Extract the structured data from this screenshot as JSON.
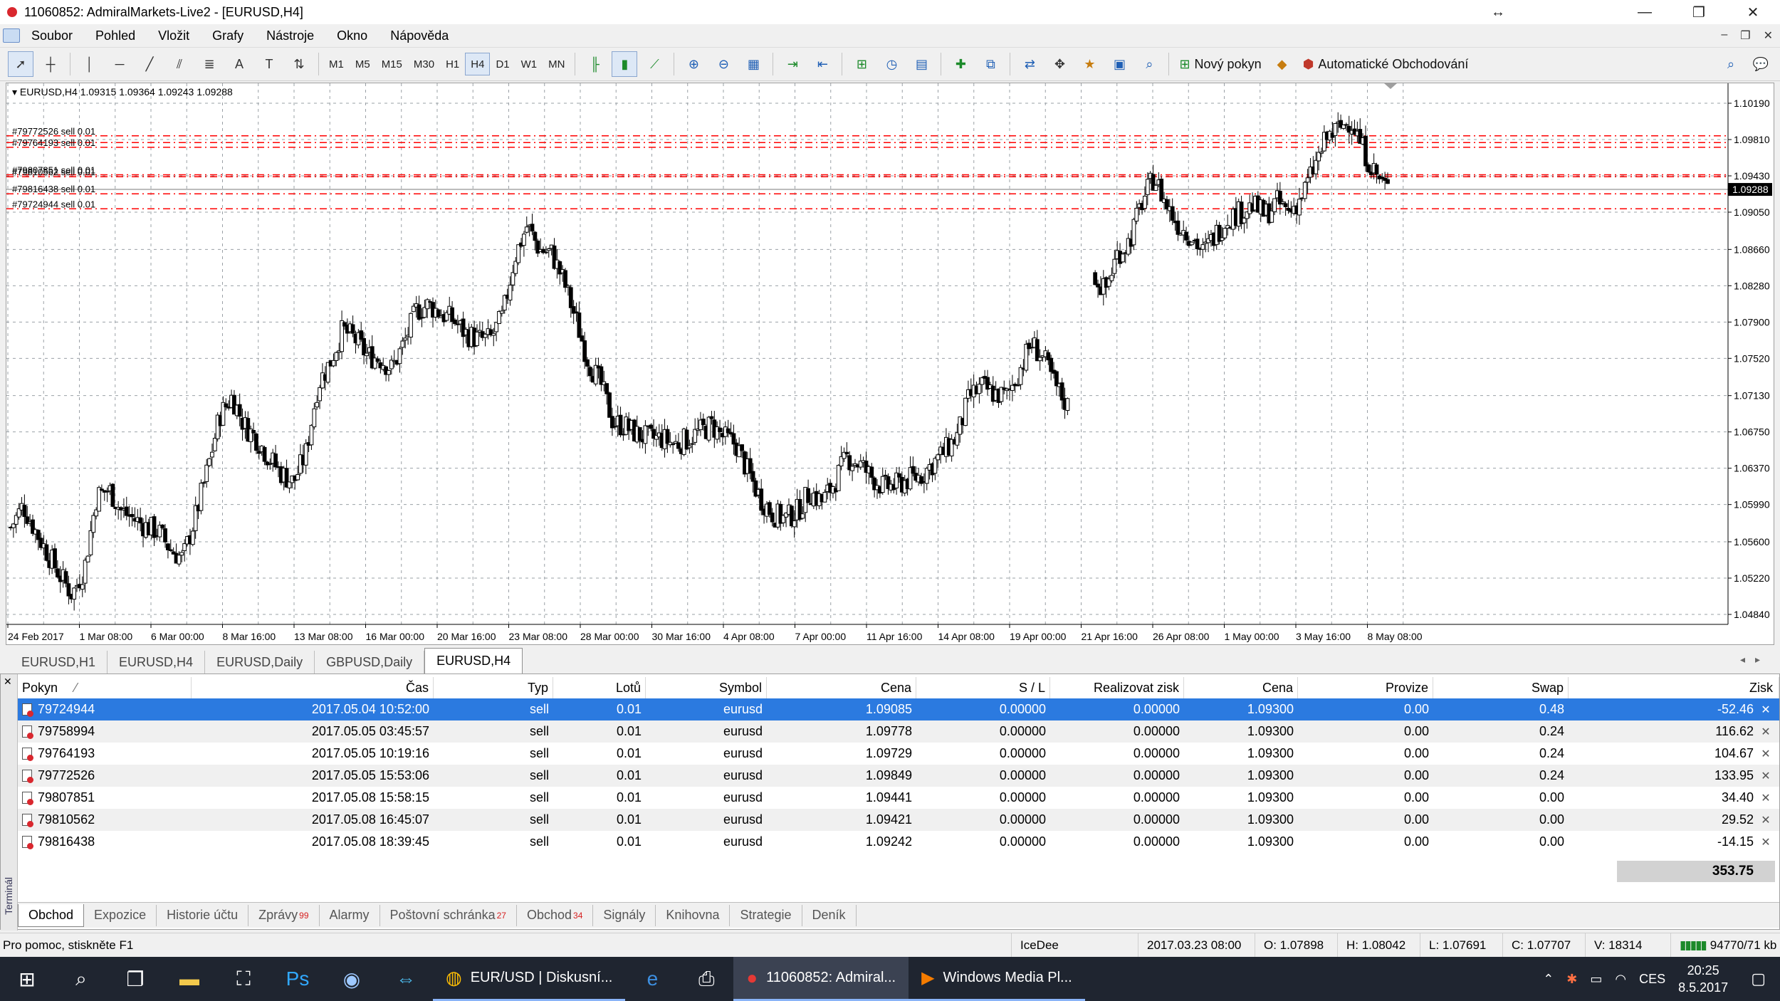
{
  "window": {
    "title": "11060852: AdmiralMarkets-Live2 - [EURUSD,H4]",
    "controls": {
      "minimize": "—",
      "restore": "❐",
      "close": "✕",
      "resize": "↔"
    }
  },
  "menu": {
    "items": [
      "Soubor",
      "Pohled",
      "Vložit",
      "Grafy",
      "Nástroje",
      "Okno",
      "Nápověda"
    ]
  },
  "toolbar": {
    "timeframes": [
      "M1",
      "M5",
      "M15",
      "M30",
      "H1",
      "H4",
      "D1",
      "W1",
      "MN"
    ],
    "active_timeframe": "H4",
    "new_order_label": "Nový pokyn",
    "auto_trading_label": "Automatické Obchodování"
  },
  "chart": {
    "info_line": "EURUSD,H4  1.09315 1.09364 1.09243 1.09288",
    "current_price": "1.09288",
    "order_labels": [
      {
        "text": "#79772526 sell 0.01",
        "price": 1.09849
      },
      {
        "text": "#79764193 sell 0.01",
        "price": 1.09729
      },
      {
        "text": "#79807851 sell 0.01",
        "price": 1.09441
      },
      {
        "text": "#79810562 sell 0.01",
        "price": 1.09421
      },
      {
        "text": "#79816438 sell 0.01",
        "price": 1.09242
      },
      {
        "text": "#79724944 sell 0.01",
        "price": 1.09085
      }
    ],
    "extra_line_price": 1.09778
  },
  "chart_data": {
    "type": "candlestick",
    "title": "EURUSD,H4",
    "ylim": [
      1.0484,
      1.1019
    ],
    "y_ticks": [
      "1.10190",
      "1.09810",
      "1.09430",
      "1.09050",
      "1.08660",
      "1.08280",
      "1.07900",
      "1.07520",
      "1.07130",
      "1.06750",
      "1.06370",
      "1.05990",
      "1.05600",
      "1.05220",
      "1.04840"
    ],
    "x_ticks": [
      "24 Feb 2017",
      "1 Mar 08:00",
      "6 Mar 00:00",
      "8 Mar 16:00",
      "13 Mar 08:00",
      "16 Mar 00:00",
      "20 Mar 16:00",
      "23 Mar 08:00",
      "28 Mar 00:00",
      "30 Mar 16:00",
      "4 Apr 08:00",
      "7 Apr 00:00",
      "11 Apr 16:00",
      "14 Apr 08:00",
      "19 Apr 00:00",
      "21 Apr 16:00",
      "26 Apr 08:00",
      "1 May 00:00",
      "3 May 16:00",
      "8 May 08:00"
    ],
    "close_path": [
      1.0575,
      1.0598,
      1.0572,
      1.0548,
      1.0525,
      1.0505,
      1.0532,
      1.0608,
      1.0615,
      1.0592,
      1.0584,
      1.0576,
      1.0571,
      1.0552,
      1.0542,
      1.0585,
      1.0635,
      1.0692,
      1.0712,
      1.0682,
      1.0668,
      1.0648,
      1.0632,
      1.0622,
      1.0652,
      1.0725,
      1.0748,
      1.0782,
      1.0772,
      1.0755,
      1.0752,
      1.0741,
      1.0768,
      1.0802,
      1.0808,
      1.0799,
      1.0792,
      1.0778,
      1.0772,
      1.0772,
      1.0795,
      1.0858,
      1.0891,
      1.0866,
      1.0862,
      1.0832,
      1.0791,
      1.0748,
      1.0725,
      1.0685,
      1.0681,
      1.0672,
      1.0668,
      1.0668,
      1.0662,
      1.0667,
      1.0675,
      1.0682,
      1.0669,
      1.0662,
      1.0632,
      1.0605,
      1.0589,
      1.0584,
      1.0592,
      1.0612,
      1.0602,
      1.0622,
      1.0648,
      1.0642,
      1.0628,
      1.0617,
      1.0619,
      1.0625,
      1.0629,
      1.0642,
      1.0655,
      1.0671,
      1.0712,
      1.0722,
      1.0715,
      1.0712,
      1.0738,
      1.0768,
      1.0752,
      1.0722,
      1.0702,
      null,
      1.0842,
      1.0822,
      1.0861,
      1.0875,
      1.0915,
      1.0942,
      1.0912,
      1.0891,
      1.0881,
      1.0862,
      1.0882,
      1.0899,
      1.0905,
      1.0912,
      1.0902,
      1.0915,
      1.0905,
      1.0921,
      1.0951,
      1.0982,
      1.0992,
      1.1002,
      1.0971,
      1.0945,
      1.0929
    ],
    "series_color": "#000000",
    "up_candle_fill": "#ffffff",
    "down_candle_fill": "#000000",
    "order_line_color": "#ff0000"
  },
  "chart_tabs": [
    "EURUSD,H1",
    "EURUSD,H4",
    "EURUSD,Daily",
    "GBPUSD,Daily",
    "EURUSD,H4"
  ],
  "active_chart_tab": 4,
  "terminal": {
    "side_label": "Terminál",
    "columns": [
      "Pokyn",
      "Čas",
      "Typ",
      "Lotů",
      "Symbol",
      "Cena",
      "S / L",
      "Realizovat zisk",
      "Cena",
      "Provize",
      "Swap",
      "Zisk"
    ],
    "sort_indicator": "⁄",
    "rows": [
      [
        "79724944",
        "2017.05.04 10:52:00",
        "sell",
        "0.01",
        "eurusd",
        "1.09085",
        "0.00000",
        "0.00000",
        "1.09300",
        "0.00",
        "0.48",
        "-52.46"
      ],
      [
        "79758994",
        "2017.05.05 03:45:57",
        "sell",
        "0.01",
        "eurusd",
        "1.09778",
        "0.00000",
        "0.00000",
        "1.09300",
        "0.00",
        "0.24",
        "116.62"
      ],
      [
        "79764193",
        "2017.05.05 10:19:16",
        "sell",
        "0.01",
        "eurusd",
        "1.09729",
        "0.00000",
        "0.00000",
        "1.09300",
        "0.00",
        "0.24",
        "104.67"
      ],
      [
        "79772526",
        "2017.05.05 15:53:06",
        "sell",
        "0.01",
        "eurusd",
        "1.09849",
        "0.00000",
        "0.00000",
        "1.09300",
        "0.00",
        "0.24",
        "133.95"
      ],
      [
        "79807851",
        "2017.05.08 15:58:15",
        "sell",
        "0.01",
        "eurusd",
        "1.09441",
        "0.00000",
        "0.00000",
        "1.09300",
        "0.00",
        "0.00",
        "34.40"
      ],
      [
        "79810562",
        "2017.05.08 16:45:07",
        "sell",
        "0.01",
        "eurusd",
        "1.09421",
        "0.00000",
        "0.00000",
        "1.09300",
        "0.00",
        "0.00",
        "29.52"
      ],
      [
        "79816438",
        "2017.05.08 18:39:45",
        "sell",
        "0.01",
        "eurusd",
        "1.09242",
        "0.00000",
        "0.00000",
        "1.09300",
        "0.00",
        "0.00",
        "-14.15"
      ]
    ],
    "selected_row": 0,
    "total": "353.75",
    "tabs": [
      {
        "label": "Obchod",
        "badge": ""
      },
      {
        "label": "Expozice",
        "badge": ""
      },
      {
        "label": "Historie účtu",
        "badge": ""
      },
      {
        "label": "Zprávy",
        "badge": "99"
      },
      {
        "label": "Alarmy",
        "badge": ""
      },
      {
        "label": "Poštovní schránka",
        "badge": "27"
      },
      {
        "label": "Obchod",
        "badge": "34"
      },
      {
        "label": "Signály",
        "badge": ""
      },
      {
        "label": "Knihovna",
        "badge": ""
      },
      {
        "label": "Strategie",
        "badge": ""
      },
      {
        "label": "Deník",
        "badge": ""
      }
    ],
    "active_tab": 0
  },
  "status": {
    "help": "Pro pomoc, stiskněte F1",
    "profile": "IceDee",
    "datetime": "2017.03.23 08:00",
    "open": "O: 1.07898",
    "high": "H: 1.08042",
    "low": "L: 1.07691",
    "close": "C: 1.07707",
    "volume": "V: 18314",
    "traffic": "94770/71 kb"
  },
  "taskbar": {
    "apps": [
      {
        "label": "EUR/USD | Diskusní...",
        "icon": "chrome-icon"
      },
      {
        "label": "11060852: Admiral...",
        "icon": "mt4-icon"
      },
      {
        "label": "Windows Media Pl...",
        "icon": "media-player-icon"
      }
    ],
    "lang": "CES",
    "time": "20:25",
    "date": "8.5.2017"
  }
}
